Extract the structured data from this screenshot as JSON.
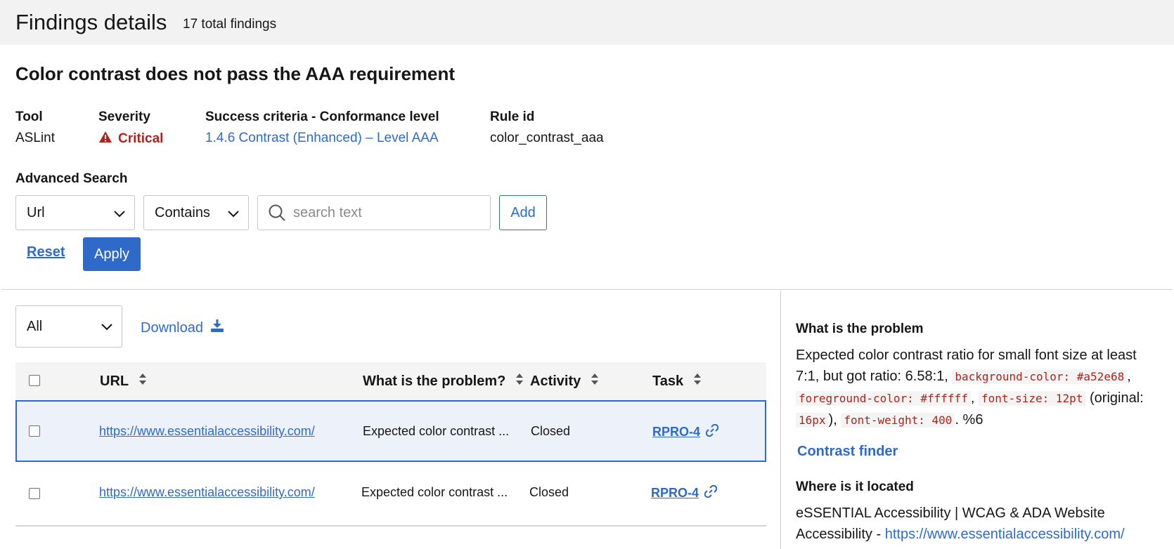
{
  "header": {
    "title": "Findings details",
    "total": "17 total findings"
  },
  "issue": {
    "title": "Color contrast does not pass the AAA requirement"
  },
  "meta": {
    "tool_label": "Tool",
    "tool_value": "ASLint",
    "severity_label": "Severity",
    "severity_value": "Critical",
    "criteria_label": "Success criteria - Conformance level",
    "criteria_value": "1.4.6 Contrast (Enhanced) – Level AAA",
    "rule_label": "Rule id",
    "rule_value": "color_contrast_aaa"
  },
  "advanced_search": {
    "label": "Advanced Search",
    "field_select": "Url",
    "operator_select": "Contains",
    "search_placeholder": "search text",
    "search_value": "",
    "add_label": "Add",
    "reset_label": "Reset",
    "apply_label": "Apply"
  },
  "toolbar": {
    "filter_select": "All",
    "download_label": "Download"
  },
  "table": {
    "columns": [
      "URL",
      "What is the problem?",
      "Activity",
      "Task"
    ],
    "rows": [
      {
        "url": "https://www.essentialaccessibility.com/",
        "problem": "Expected color contrast ...",
        "activity": "Closed",
        "task": "RPRO-4"
      },
      {
        "url": "https://www.essentialaccessibility.com/",
        "problem": "Expected color contrast ...",
        "activity": "Closed",
        "task": "RPRO-4"
      }
    ]
  },
  "detail": {
    "problem_heading": "What is the problem",
    "problem_text_1": "Expected color contrast ratio for small font size at least 7:1, but got ratio: 6.58:1,",
    "code_bg": "background-color: #a52e68",
    "code_fg": "foreground-color: #ffffff",
    "code_fs": "font-size: 12pt",
    "original_prefix": "(original:",
    "code_orig": "16px",
    "original_suffix": "),",
    "code_fw": "font-weight: 400",
    "trailing": ". %6",
    "contrast_finder": "Contrast finder",
    "location_heading": "Where is it located",
    "location_text": "eSSENTIAL Accessibility | WCAG & ADA Website Accessibility -",
    "location_link": "https://www.essentialaccessibility.com/"
  },
  "colors": {
    "accent": "#2f6ac9",
    "critical": "#b0231c",
    "header_bg": "#f2f2f2"
  }
}
